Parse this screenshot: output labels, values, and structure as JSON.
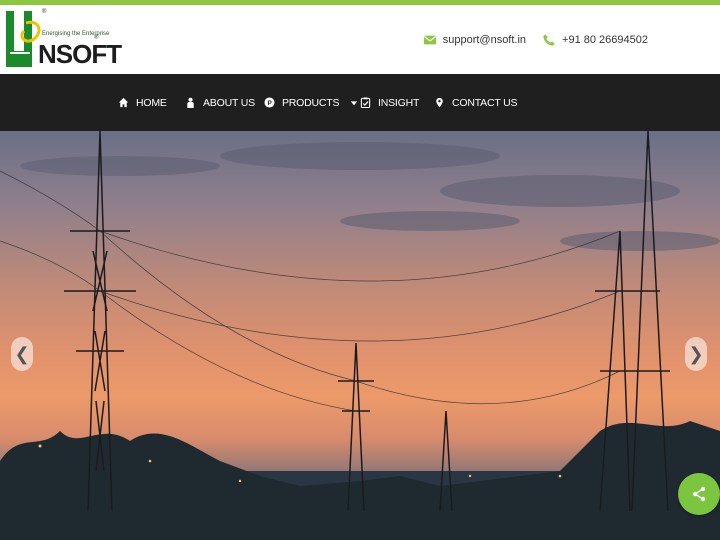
{
  "brand": {
    "name": "NSOFT",
    "tagline": "Energising the Enterprise",
    "reg_mark": "®",
    "accent_color": "#8dc63f",
    "logo_color": "#1a8a2a"
  },
  "contact": {
    "email": "support@nsoft.in",
    "phone": "+91 80 26694502",
    "email_icon": "envelope-icon",
    "phone_icon": "phone-icon"
  },
  "nav": {
    "items": [
      {
        "label": "HOME",
        "icon": "home-icon"
      },
      {
        "label": "ABOUT US",
        "icon": "person-icon"
      },
      {
        "label": "PRODUCTS",
        "icon": "product-p-icon",
        "dropdown": true
      },
      {
        "label": "INSIGHT",
        "icon": "clipboard-check-icon"
      },
      {
        "label": "CONTACT US",
        "icon": "map-pin-icon"
      }
    ]
  },
  "slider": {
    "prev_glyph": "❮",
    "next_glyph": "❯"
  },
  "share": {
    "icon": "share-icon",
    "color": "#7cc53f"
  }
}
